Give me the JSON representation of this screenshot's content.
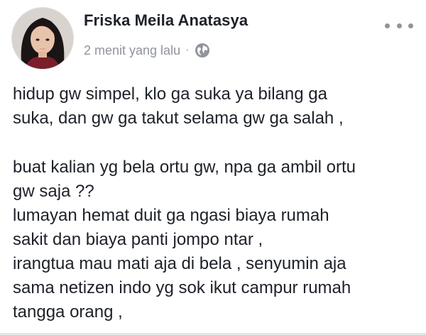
{
  "post": {
    "author": "Friska Meila Anatasya",
    "timestamp": "2 menit yang lalu",
    "separator": "·",
    "privacy_icon": "globe-icon",
    "more_icon": "more-options-icon",
    "paragraphs": [
      {
        "lines": [
          "hidup gw simpel, klo ga suka ya bilang ga",
          "suka, dan gw ga takut selama gw ga salah ,"
        ]
      },
      {
        "lines": [
          "buat kalian yg bela ortu gw, npa ga ambil ortu",
          "gw saja ??",
          "lumayan hemat duit ga ngasi biaya rumah",
          "sakit dan biaya panti jompo ntar ,",
          "irangtua mau mati aja di bela , senyumin aja",
          "sama netizen indo yg sok ikut campur rumah",
          "tangga orang ,"
        ]
      }
    ]
  },
  "colors": {
    "name": "#1d2129",
    "meta": "#90949c",
    "text": "#1d2129"
  }
}
